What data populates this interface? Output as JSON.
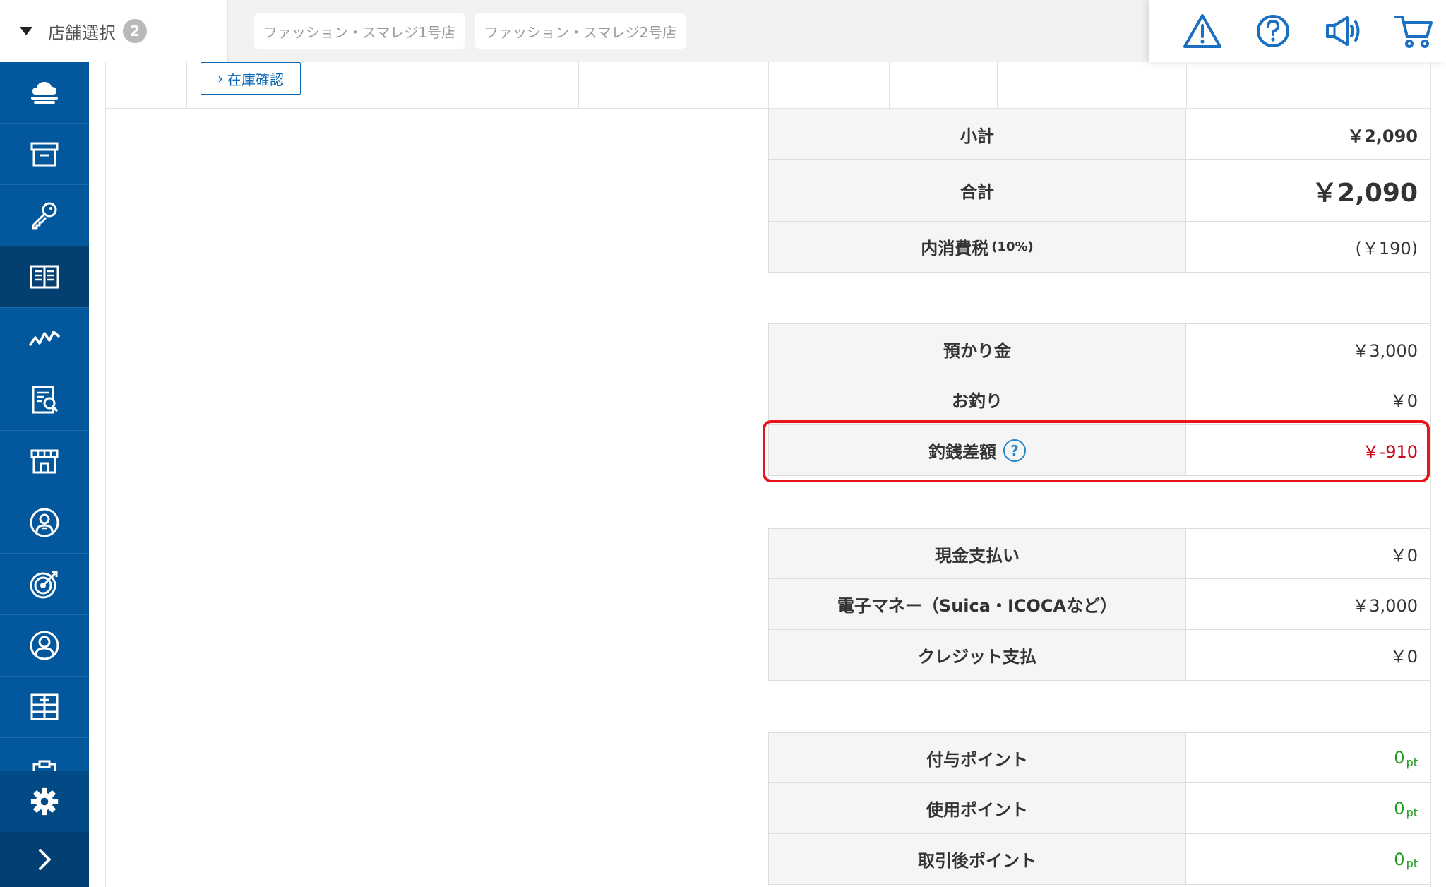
{
  "header": {
    "store_select_label": "店舗選択",
    "store_count": "2",
    "stores": [
      "ファッション・スマレジ1号店",
      "ファッション・スマレジ2号店"
    ]
  },
  "icons": {
    "top": [
      "warning-icon",
      "help-icon",
      "megaphone-icon",
      "cart-icon"
    ],
    "sidebar": [
      "cloud-icon",
      "archive-icon",
      "key-icon",
      "book-icon",
      "chart-icon",
      "report-icon",
      "store-icon",
      "person-badge-icon",
      "target-icon",
      "user-icon",
      "grid-icon",
      "clipboard-icon",
      "gear-icon",
      "chevron-right-icon"
    ]
  },
  "colors": {
    "sidebar": "#03579c",
    "sidebar_active": "#043f72",
    "accent": "#0a6ab9",
    "negative": "#d0021b",
    "points": "#1a9a1a",
    "highlight": "#e8141c"
  },
  "main": {
    "stock_check_label": "在庫確認"
  },
  "summary": {
    "subtotal": {
      "label": "小計",
      "value": "￥2,090"
    },
    "total": {
      "label": "合計",
      "value": "￥2,090"
    },
    "tax": {
      "label": "内消費税",
      "note": "(10%)",
      "value": "(￥190)"
    },
    "deposit": {
      "label": "預かり金",
      "value": "￥3,000"
    },
    "change": {
      "label": "お釣り",
      "value": "￥0"
    },
    "change_diff": {
      "label": "釣銭差額",
      "help": "?",
      "value": "￥-910"
    },
    "cash": {
      "label": "現金支払い",
      "value": "￥0"
    },
    "emoney": {
      "label": "電子マネー（Suica・ICOCAなど）",
      "value": "￥3,000"
    },
    "credit": {
      "label": "クレジット支払",
      "value": "￥0"
    },
    "points_given": {
      "label": "付与ポイント",
      "value": "0",
      "unit": "pt"
    },
    "points_used": {
      "label": "使用ポイント",
      "value": "0",
      "unit": "pt"
    },
    "points_after": {
      "label": "取引後ポイント",
      "value": "0",
      "unit": "pt"
    }
  }
}
